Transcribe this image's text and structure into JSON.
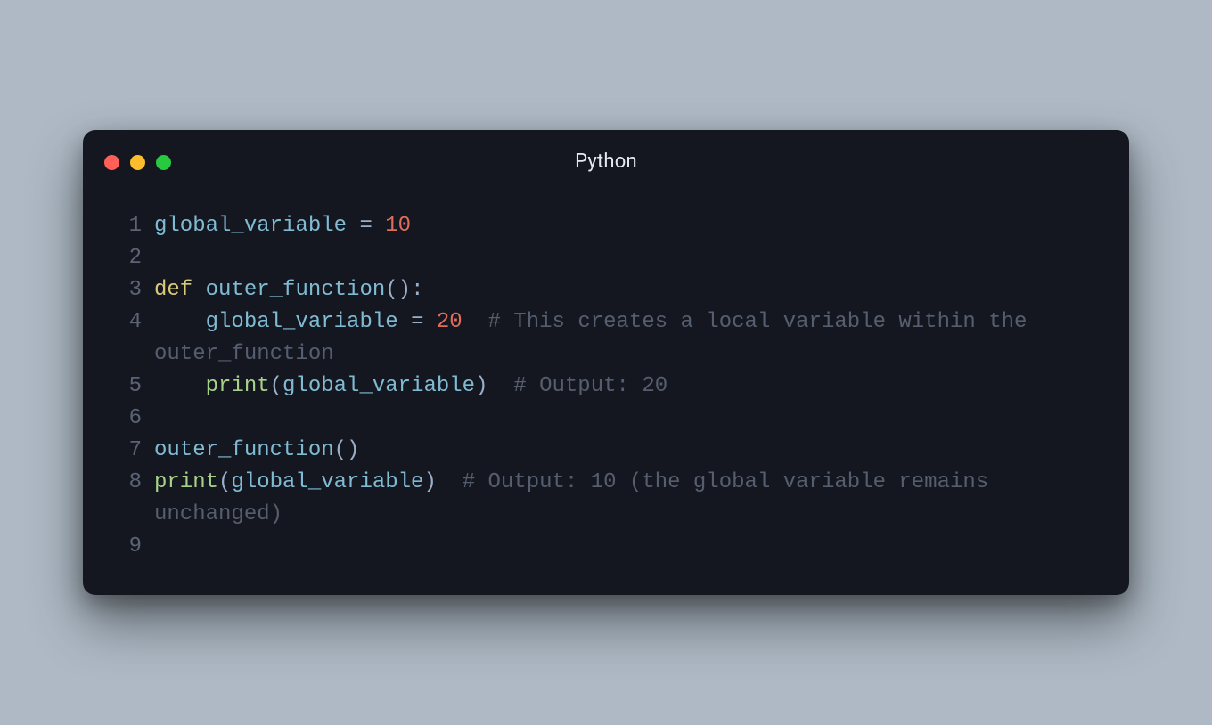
{
  "window": {
    "title": "Python"
  },
  "traffic": {
    "red": "#ff5f56",
    "yellow": "#ffbd2e",
    "green": "#27c93f"
  },
  "gutter": {
    "l1": "1",
    "l2": "2",
    "l3": "3",
    "l4": "4",
    "l5": "5",
    "l6": "6",
    "l7": "7",
    "l8": "8",
    "l9": "9"
  },
  "code": {
    "l1": {
      "var": "global_variable",
      "sp1": " ",
      "op": "=",
      "sp2": " ",
      "num": "10"
    },
    "l2": {
      "blank": ""
    },
    "l3": {
      "kw": "def",
      "sp": " ",
      "name": "outer_function",
      "paren": "():"
    },
    "l4": {
      "indent": "    ",
      "var": "global_variable",
      "sp1": " ",
      "op": "=",
      "sp2": " ",
      "num": "20",
      "gap": "  ",
      "comment": "# This creates a local variable within the outer_function"
    },
    "l5": {
      "indent": "    ",
      "func": "print",
      "open": "(",
      "arg": "global_variable",
      "close": ")",
      "gap": "  ",
      "comment": "# Output: 20"
    },
    "l6": {
      "blank": ""
    },
    "l7": {
      "call": "outer_function",
      "paren": "()"
    },
    "l8": {
      "func": "print",
      "open": "(",
      "arg": "global_variable",
      "close": ")",
      "gap": "  ",
      "comment": "# Output: 10 (the global variable remains unchanged)"
    },
    "l9": {
      "blank": ""
    }
  }
}
